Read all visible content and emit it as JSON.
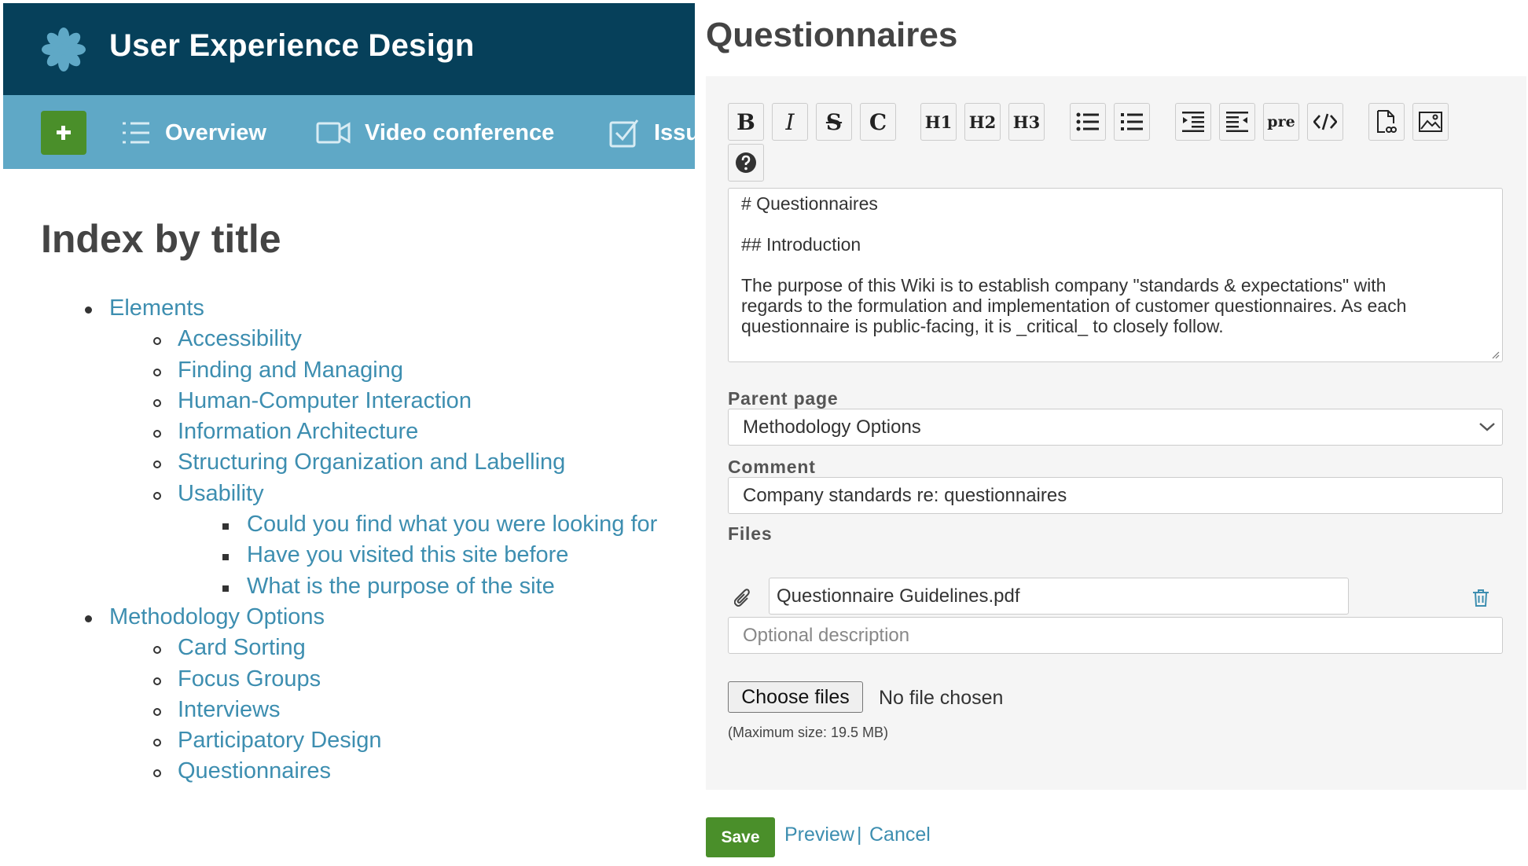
{
  "header": {
    "project_title": "User Experience Design",
    "nav": {
      "overview": "Overview",
      "video": "Video conference",
      "issues": "Issues"
    }
  },
  "index": {
    "title": "Index by title",
    "items": [
      {
        "level": 1,
        "label": "Elements"
      },
      {
        "level": 2,
        "label": "Accessibility"
      },
      {
        "level": 2,
        "label": "Finding and Managing"
      },
      {
        "level": 2,
        "label": "Human-Computer Interaction"
      },
      {
        "level": 2,
        "label": "Information Architecture"
      },
      {
        "level": 2,
        "label": "Structuring Organization and Labelling"
      },
      {
        "level": 2,
        "label": "Usability"
      },
      {
        "level": 3,
        "label": "Could you find what you were looking for"
      },
      {
        "level": 3,
        "label": "Have you visited this site before"
      },
      {
        "level": 3,
        "label": "What is the purpose of the site"
      },
      {
        "level": 1,
        "label": "Methodology Options"
      },
      {
        "level": 2,
        "label": "Card Sorting"
      },
      {
        "level": 2,
        "label": "Focus Groups"
      },
      {
        "level": 2,
        "label": "Interviews"
      },
      {
        "level": 2,
        "label": "Participatory Design"
      },
      {
        "level": 2,
        "label": "Questionnaires"
      }
    ]
  },
  "editor_page": {
    "heading": "Questionnaires",
    "toolbar": {
      "bold": "B",
      "italic": "I",
      "strike": "S",
      "code": "C",
      "h1": "H1",
      "h2": "H2",
      "h3": "H3",
      "pre": "pre"
    },
    "text_lines": [
      "# Questionnaires",
      "",
      "## Introduction",
      "",
      "The purpose of this Wiki is to establish company \"standards & expectations\" with",
      "regards to the formulation and implementation of customer questionnaires. As each",
      "questionnaire is public-facing, it is _critical_ to closely follow."
    ],
    "parent_label": "Parent page",
    "parent_value": "Methodology Options",
    "comment_label": "Comment",
    "comment_value": "Company standards re: questionnaires",
    "files_label": "Files",
    "file_name": "Questionnaire Guidelines.pdf",
    "description_placeholder": "Optional description",
    "choose_files": "Choose files",
    "no_file": "No file chosen",
    "max_size": "(Maximum size: 19.5 MB)",
    "save": "Save",
    "preview": "Preview",
    "separator": "|",
    "cancel": "Cancel"
  },
  "colors": {
    "header_bg": "#06405a",
    "nav_bg": "#5fa8c6",
    "accent_green": "#4a8f2a",
    "link": "#3d8eb0"
  }
}
